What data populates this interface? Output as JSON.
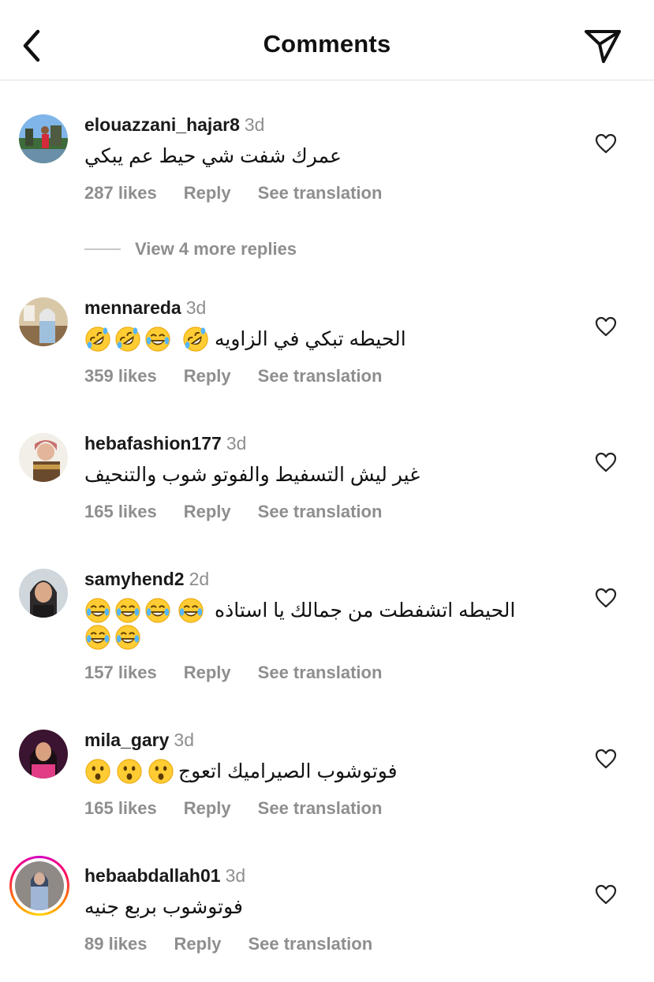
{
  "header": {
    "title": "Comments"
  },
  "actions": {
    "reply": "Reply",
    "translate": "See translation"
  },
  "view_more_replies": "View 4 more replies",
  "comments": [
    {
      "username": "elouazzani_hajar8",
      "time": "3d",
      "text": "عمرك شفت شي حيط عم يبكي",
      "emojis": [],
      "likes": "287 likes"
    },
    {
      "username": "mennareda",
      "time": "3d",
      "text": "الحيطه تبكي في الزاويه",
      "emojis": [
        "rofl",
        "joy",
        "rofl",
        "rofl"
      ],
      "likes": "359 likes"
    },
    {
      "username": "hebafashion177",
      "time": "3d",
      "text": "غير ليش التسفيط والفوتو شوب والتنحيف",
      "emojis": [],
      "likes": "165 likes"
    },
    {
      "username": "samyhend2",
      "time": "2d",
      "text": "الحيطه اتشفطت من جمالك يا استاذه",
      "emojis": [
        "joy",
        "joy",
        "joy",
        "joy",
        "joy",
        "joy"
      ],
      "likes": "157 likes"
    },
    {
      "username": "mila_gary",
      "time": "3d",
      "text": "فوتوشوب الصيراميك اتعوج",
      "emojis": [
        "hushed",
        "hushed",
        "hushed"
      ],
      "likes": "165 likes"
    },
    {
      "username": "hebaabdallah01",
      "time": "3d",
      "text": "فوتوشوب بربع جنيه",
      "emojis": [],
      "likes": "89 likes"
    }
  ],
  "colors": {
    "muted": "#8e8e8e",
    "divider": "#e2e2e2",
    "text": "#111111",
    "story_ring": "#ff0069"
  },
  "icons": {
    "back": "chevron-left-icon",
    "share": "paper-plane-icon",
    "like": "heart-outline-icon"
  }
}
